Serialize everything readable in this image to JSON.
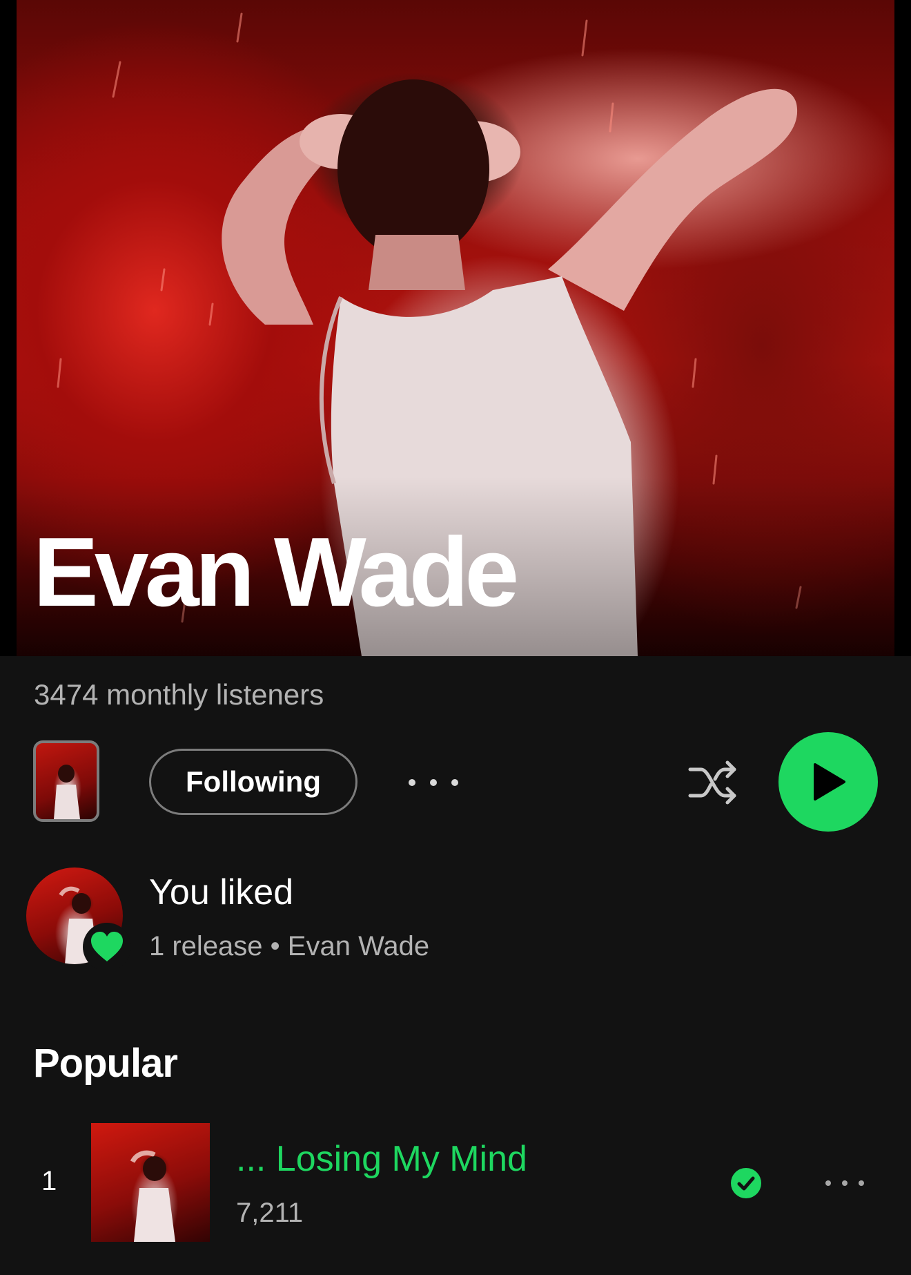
{
  "artist": {
    "name": "Evan Wade",
    "monthly_listeners": "3474 monthly listeners"
  },
  "actions": {
    "follow_label": "Following",
    "more_icon": "more-horizontal-icon",
    "shuffle_icon": "shuffle-icon",
    "play_icon": "play-icon"
  },
  "liked": {
    "title": "You liked",
    "subtitle": "1 release • Evan Wade",
    "badge_icon": "heart-icon"
  },
  "popular": {
    "section_title": "Popular",
    "tracks": [
      {
        "number": "1",
        "title": "... Losing My Mind",
        "plays": "7,211",
        "downloaded_icon": "check-circle-icon",
        "more_icon": "more-horizontal-icon"
      }
    ]
  },
  "colors": {
    "accent": "#1ed760",
    "background": "#121212",
    "secondary_text": "#b3b3b3"
  }
}
